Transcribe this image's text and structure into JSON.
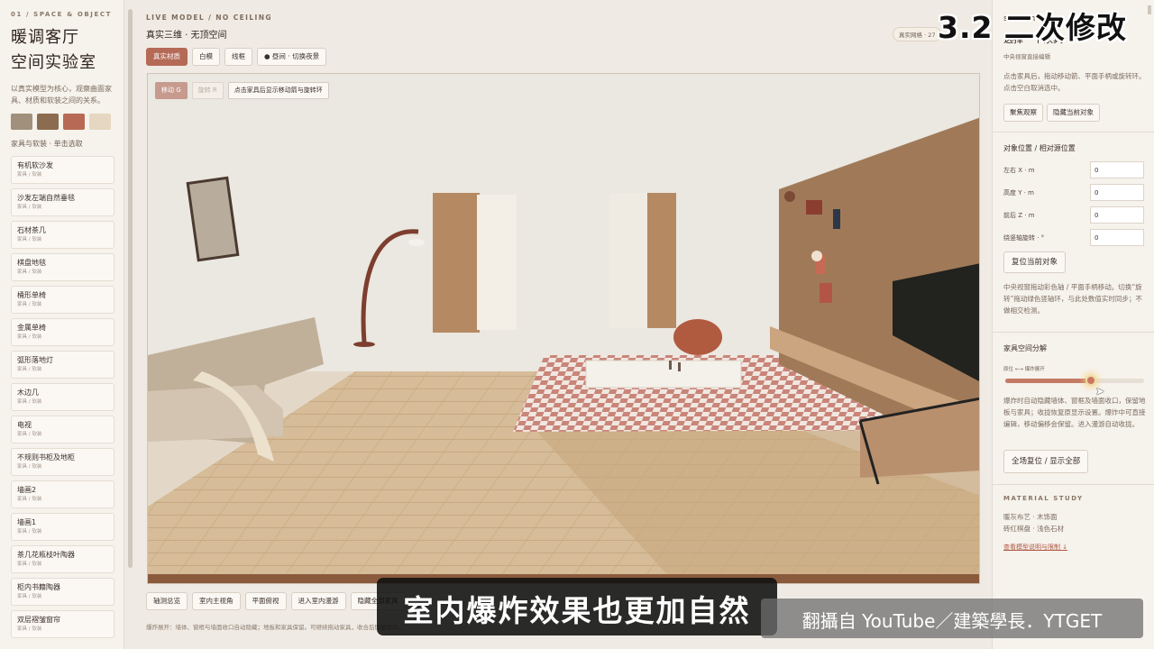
{
  "left": {
    "eyebrow": "01 / SPACE & OBJECT",
    "title_line1": "暖调客厅",
    "title_line2": "空间实验室",
    "desc": "以真实模型为核心，观察曲面家具、材质和软装之间的关系。",
    "swatches": [
      "#a1907c",
      "#8b6c50",
      "#b86955",
      "#e5d7c1"
    ],
    "section_label": "家具与软装 · 单击选取",
    "items": [
      {
        "name": "有机软沙发",
        "sub": "家具 / 软装"
      },
      {
        "name": "沙发左端自然垂毯",
        "sub": "家具 / 软装"
      },
      {
        "name": "石材茶几",
        "sub": "家具 / 软装"
      },
      {
        "name": "棋盘地毯",
        "sub": "家具 / 软装"
      },
      {
        "name": "桶形单椅",
        "sub": "家具 / 软装"
      },
      {
        "name": "金属单椅",
        "sub": "家具 / 软装"
      },
      {
        "name": "弧形落地灯",
        "sub": "家具 / 软装"
      },
      {
        "name": "木边几",
        "sub": "家具 / 软装"
      },
      {
        "name": "电视",
        "sub": "家具 / 软装"
      },
      {
        "name": "不规则书柜及地柜",
        "sub": "家具 / 软装"
      },
      {
        "name": "墙画2",
        "sub": "家具 / 软装"
      },
      {
        "name": "墙画1",
        "sub": "家具 / 软装"
      },
      {
        "name": "茶几花瓶枝叶陶器",
        "sub": "家具 / 软装"
      },
      {
        "name": "柜内书籍陶器",
        "sub": "家具 / 软装"
      },
      {
        "name": "双层褶皱窗帘",
        "sub": "家具 / 软装"
      }
    ]
  },
  "center": {
    "eyebrow": "LIVE MODEL / NO CEILING",
    "title": "真实三维 · 无顶空间",
    "badge": "真实网格 · 27",
    "tabs": [
      "真实材质",
      "白模",
      "线框",
      "● 昼间 · 切换夜景"
    ],
    "viewport_tools": {
      "move": "移动 G",
      "rotate": "旋转 R",
      "hint": "点击家具后显示移动箭与旋转环"
    },
    "bottom_buttons": [
      "轴测总览",
      "室内主视角",
      "平面俯视",
      "进入室内漫游",
      "隐藏全部家具"
    ],
    "note": "爆炸展开：墙体、窗框与墙面收口自动隐藏；地板和家具保留。可继续拖动家具，收合后恢复原状。"
  },
  "right": {
    "eyebrow": "SELECTED",
    "title": "选择一个家具",
    "subtitle": "中央视窗直接编辑",
    "desc": "点击家具后，拖动移动箭、平面手柄或旋转环。点击空白取消选中。",
    "btn_focus": "聚焦观察",
    "btn_hide": "隐藏当前对象",
    "pos_section": "对象位置 / 相对源位置",
    "fields": [
      {
        "label": "左右 X · m",
        "value": "0"
      },
      {
        "label": "高度 Y · m",
        "value": "0"
      },
      {
        "label": "前后 Z · m",
        "value": "0"
      },
      {
        "label": "绕竖轴旋转 · °",
        "value": "0"
      }
    ],
    "btn_reset_obj": "复位当前对象",
    "desc2": "中央视窗拖动彩色轴 / 平面手柄移动。切换“旋转”拖动绿色竖轴环，与此处数值实时同步；不做相交检测。",
    "explode_section": "家具空间分解",
    "slider_label": "原位 ←→ 爆炸展开",
    "explode_level": 0.62,
    "desc3": "爆炸时自动隐藏墙体、窗框及墙面收口，保留地板与家具；收拢恢复原显示设置。爆炸中可直接编辑，移动偏移会保留。进入漫游自动收拢。",
    "btn_reset_all": "全场复位 / 显示全部",
    "material_section": "MATERIAL STUDY",
    "material_lines": [
      "暖灰布艺 · 木饰面",
      "砖红棋盘 · 浅色石材"
    ],
    "material_link": "查看模型说明与限制 ↓"
  },
  "overlay": {
    "video_title": "3.2 二次修改",
    "subtitle": "室内爆炸效果也更加自然",
    "credit": "翻攝自 YouTube／建築學長．YTGET"
  }
}
